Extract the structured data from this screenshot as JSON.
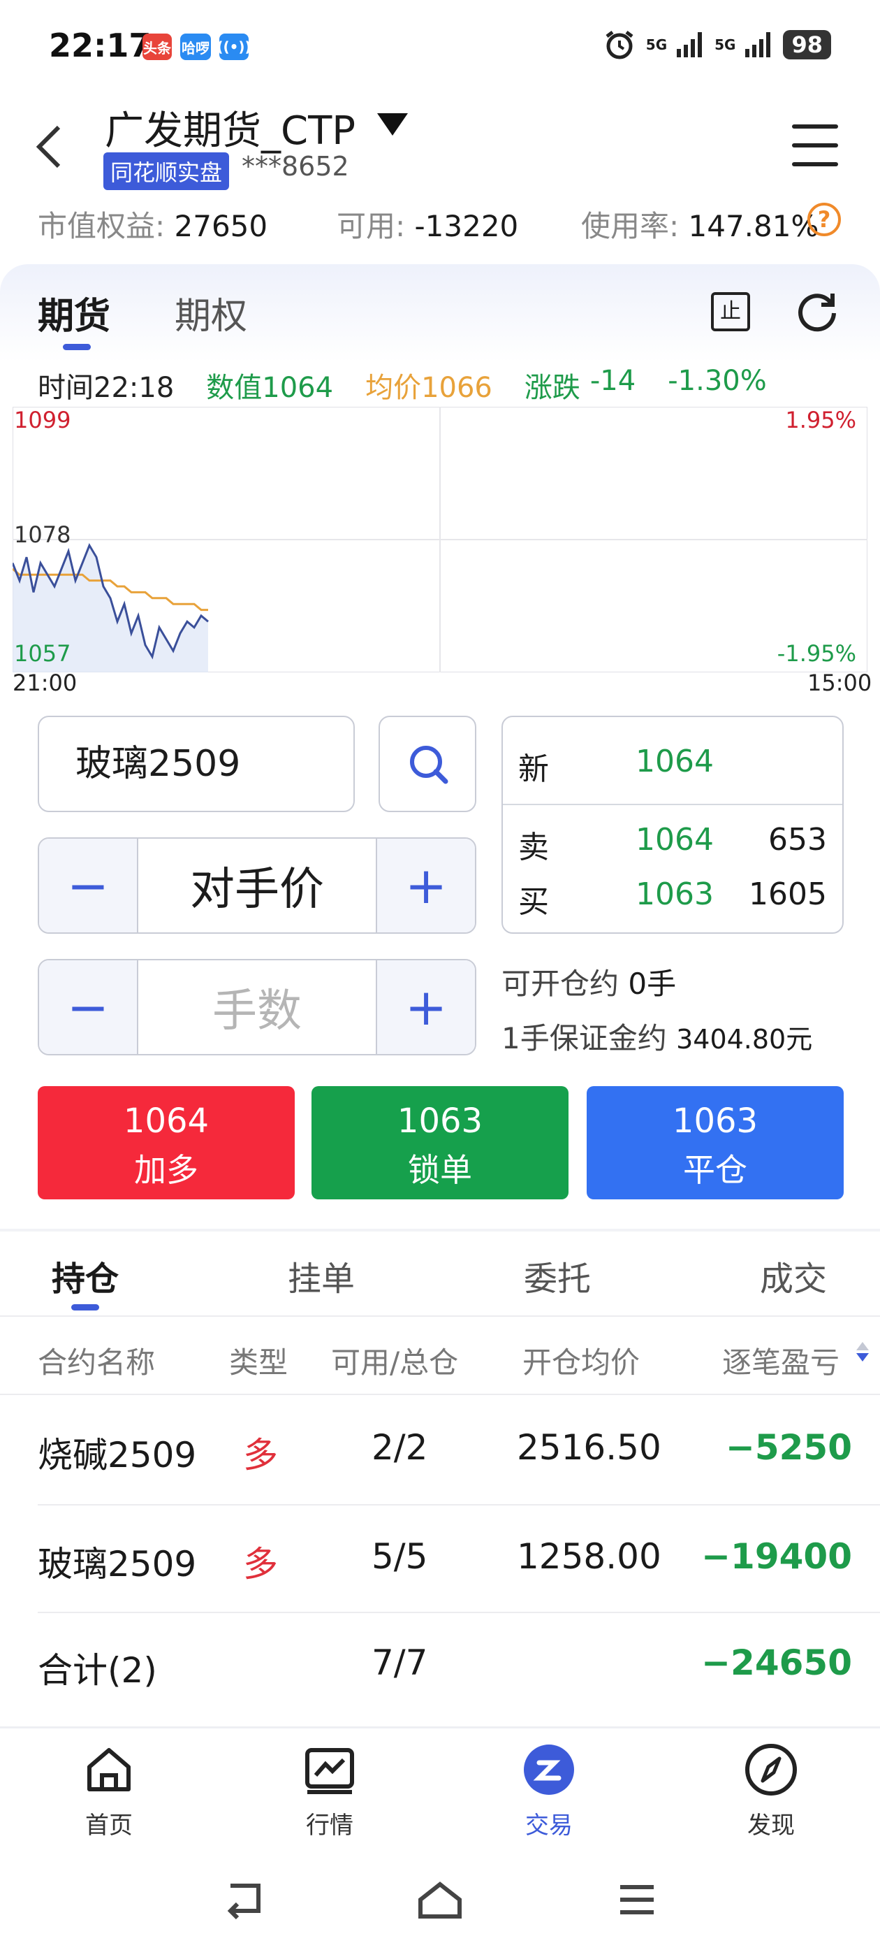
{
  "status_bar": {
    "time": "22:17",
    "badge1": "头条",
    "badge2": "哈啰",
    "signal1": "5G",
    "signal2": "5G",
    "battery": "98"
  },
  "header": {
    "title": "广发期货_CTP",
    "tag": "同花顺实盘",
    "account": "***8652"
  },
  "account_stats": {
    "equity_label": "市值权益:",
    "equity_value": "27650",
    "available_label": "可用:",
    "available_value": "-13220",
    "usage_label": "使用率:",
    "usage_value": "147.81%"
  },
  "tabs": {
    "futures": "期货",
    "options": "期权",
    "stop_icon_text": "止"
  },
  "chart_info": {
    "time": "时间22:18",
    "value": "数值1064",
    "avg": "均价1066",
    "change_label": "涨跌",
    "change": "-14",
    "change_pct": "-1.30%"
  },
  "chart_data": {
    "type": "line",
    "title": "",
    "x_start_label": "21:00",
    "x_end_label": "15:00",
    "y_labels": {
      "top": "1099",
      "mid": "1078",
      "bottom": "1057"
    },
    "pct_labels": {
      "top": "1.95%",
      "bottom": "-1.95%"
    },
    "ylim": [
      1057,
      1099
    ],
    "colors": {
      "price": "#3a4f9a",
      "avg": "#e8a23a"
    },
    "series": [
      {
        "name": "",
        "values": [
          1074,
          1071,
          1075,
          1069,
          1074,
          1072,
          1070,
          1073,
          1076,
          1071,
          1074,
          1077,
          1075,
          1070,
          1068,
          1064,
          1067,
          1062,
          1065,
          1060,
          1058,
          1063,
          1061,
          1059,
          1062,
          1064,
          1063,
          1065,
          1064
        ]
      },
      {
        "name": "",
        "values": [
          1073,
          1072,
          1072,
          1072,
          1072,
          1072,
          1072,
          1072,
          1072,
          1072,
          1072,
          1071,
          1071,
          1071,
          1071,
          1070,
          1070,
          1069,
          1069,
          1069,
          1068,
          1068,
          1068,
          1067,
          1067,
          1067,
          1067,
          1066,
          1066
        ]
      }
    ]
  },
  "order": {
    "instrument": "玻璃2509",
    "price_type": "对手价",
    "qty_placeholder": "手数",
    "minus": "−",
    "plus": "+"
  },
  "quote": {
    "last_label": "新",
    "last_price": "1064",
    "ask_label": "卖",
    "ask_price": "1064",
    "ask_vol": "653",
    "bid_label": "买",
    "bid_price": "1063",
    "bid_vol": "1605"
  },
  "open_info": {
    "text": "可开仓约",
    "value": "0手"
  },
  "margin_info": {
    "text": "1手保证金约",
    "value": "3404.80元"
  },
  "actions": [
    {
      "price": "1064",
      "label": "加多",
      "color": "#f5293b"
    },
    {
      "price": "1063",
      "label": "锁单",
      "color": "#16a04c"
    },
    {
      "price": "1063",
      "label": "平仓",
      "color": "#3371f2"
    }
  ],
  "position_tabs": [
    "持仓",
    "挂单",
    "委托",
    "成交"
  ],
  "table": {
    "headers": [
      "合约名称",
      "类型",
      "可用/总仓",
      "开仓均价",
      "逐笔盈亏"
    ],
    "rows": [
      {
        "name": "烧碱2509",
        "type": "多",
        "qty": "2/2",
        "avg": "2516.50",
        "pnl": "−5250"
      },
      {
        "name": "玻璃2509",
        "type": "多",
        "qty": "5/5",
        "avg": "1258.00",
        "pnl": "−19400"
      }
    ],
    "total": {
      "name": "合计(2)",
      "qty": "7/7",
      "pnl": "−24650"
    }
  },
  "bottom_nav": [
    {
      "label": "首页",
      "icon": "home-icon"
    },
    {
      "label": "行情",
      "icon": "chart-icon"
    },
    {
      "label": "交易",
      "icon": "trade-icon"
    },
    {
      "label": "发现",
      "icon": "compass-icon"
    }
  ]
}
